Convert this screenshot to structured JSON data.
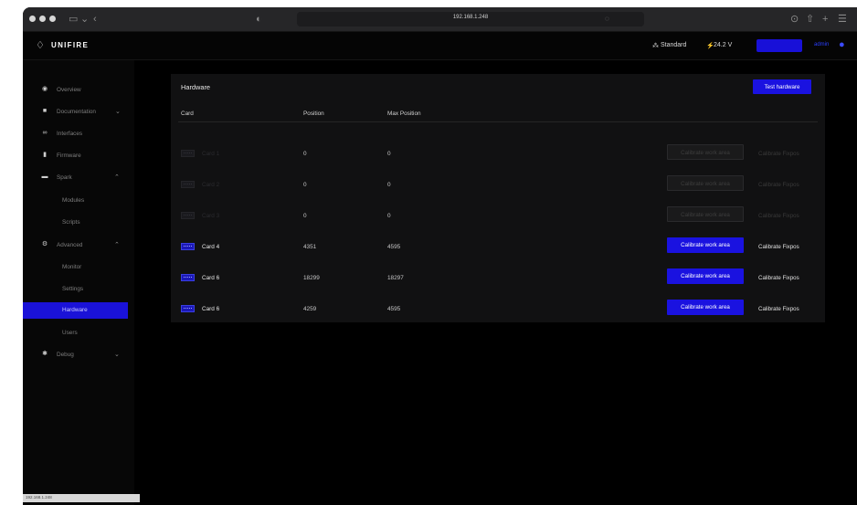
{
  "browser": {
    "url": "192.168.1.248",
    "sidebar_icon": "sidebar-icon",
    "back_icon": "chevron-left-icon",
    "shield_icon": "shield-icon",
    "reader_icon": "reader-icon",
    "download_icon": "download-icon",
    "share_icon": "share-icon",
    "new_tab_icon": "plus-icon",
    "tabs_icon": "tabs-overview-icon"
  },
  "header": {
    "brand": "UNIFIRE",
    "logo_icon": "flame-icon",
    "mode_label": "Standard",
    "voltage": "24.2 V",
    "user": "admin",
    "user_icon": "user-icon",
    "accent_color": "#1a12e0"
  },
  "sidebar": {
    "items": [
      {
        "label": "Overview",
        "icon": "overview-icon"
      },
      {
        "label": "Documentation",
        "icon": "book-icon"
      },
      {
        "label": "Interfaces",
        "icon": "link-icon"
      },
      {
        "label": "Firmware",
        "icon": "firmware-icon"
      },
      {
        "label": "Spark",
        "icon": "spark-icon"
      },
      {
        "label": "Modules"
      },
      {
        "label": "Scripts"
      },
      {
        "label": "Advanced",
        "icon": "gears-icon"
      },
      {
        "label": "Monitor"
      },
      {
        "label": "Settings"
      },
      {
        "label": "Hardware",
        "active": true
      },
      {
        "label": "Users"
      },
      {
        "label": "Debug",
        "icon": "bug-icon"
      }
    ],
    "footer_url": "192.168.1.248"
  },
  "hardware": {
    "title": "Hardware",
    "test_button": "Test hardware",
    "columns": [
      "Card",
      "Position",
      "Max Position"
    ],
    "rows": [
      {
        "name": "Card 1",
        "position": "0",
        "max_position": "0",
        "enabled": false
      },
      {
        "name": "Card 2",
        "position": "0",
        "max_position": "0",
        "enabled": false
      },
      {
        "name": "Card 3",
        "position": "0",
        "max_position": "0",
        "enabled": false
      },
      {
        "name": "Card 4",
        "position": "4351",
        "max_position": "4595",
        "enabled": true
      },
      {
        "name": "Card 6",
        "position": "18299",
        "max_position": "18297",
        "enabled": true
      },
      {
        "name": "Card 6",
        "position": "4259",
        "max_position": "4595",
        "enabled": true
      }
    ],
    "calibrate_label": "Calibrate work area",
    "fixpos_label": "Calibrate Fixpos"
  }
}
